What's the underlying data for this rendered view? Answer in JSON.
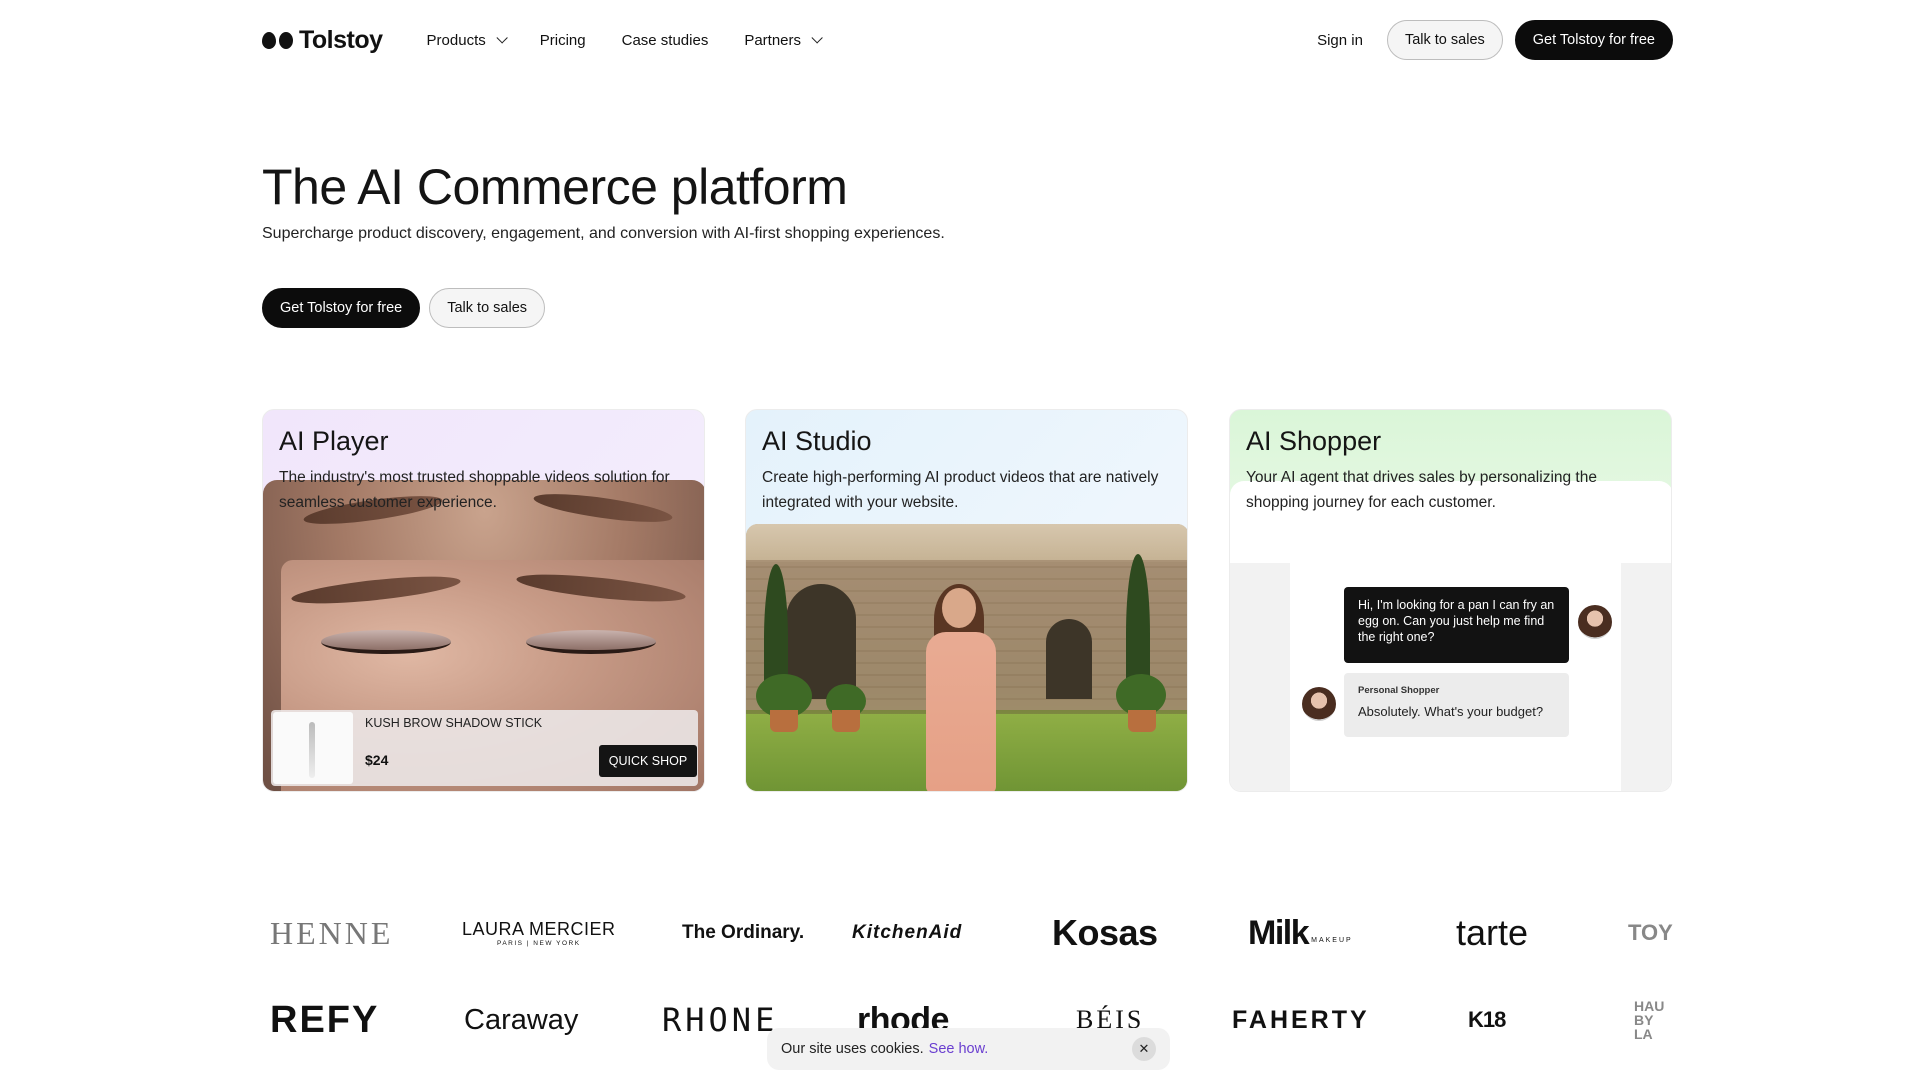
{
  "nav": {
    "logo": "Tolstoy",
    "links": [
      {
        "label": "Products",
        "dropdown": true
      },
      {
        "label": "Pricing",
        "dropdown": false
      },
      {
        "label": "Case studies",
        "dropdown": false
      },
      {
        "label": "Partners",
        "dropdown": true
      }
    ],
    "sign_in": "Sign in",
    "talk_to_sales": "Talk to sales",
    "get_free": "Get Tolstoy for free"
  },
  "hero": {
    "title": "The AI Commerce platform",
    "subtitle": "Supercharge product discovery, engagement, and conversion with AI-first shopping experiences.",
    "cta_primary": "Get Tolstoy for free",
    "cta_secondary": "Talk to sales"
  },
  "cards": {
    "player": {
      "title": "AI Player",
      "description": "The industry's most trusted shoppable videos solution for seamless customer experience.",
      "product_name": "KUSH BROW SHADOW STICK",
      "product_price": "$24",
      "quick_shop": "QUICK SHOP"
    },
    "studio": {
      "title": "AI Studio",
      "description": "Create high-performing AI product videos that are natively integrated with your website."
    },
    "shopper": {
      "title": "AI Shopper",
      "description": "Your AI agent that drives sales by personalizing the shopping journey for each customer.",
      "user_message": "Hi, I'm looking for a pan I can fry an egg on. Can you just help me find the right one?",
      "bot_label": "Personal Shopper",
      "bot_message": "Absolutely. What's your budget?"
    }
  },
  "logos": {
    "row1": [
      "HENNE",
      "LAURA MERCIER",
      "The Ordinary.",
      "KitchenAid",
      "Kosas",
      "Milk",
      "tarte",
      "TOY"
    ],
    "row1_sub": {
      "laura": "PARIS | NEW YORK",
      "milk": "MAKEUP"
    },
    "row2": [
      "REFY",
      "Caraway",
      "RHONE",
      "rhode",
      "BÉIS",
      "FAHERTY",
      "K18",
      "HAU BY LA"
    ]
  },
  "cookie": {
    "text": "Our site uses cookies.",
    "link": "See how.",
    "close": "✕"
  }
}
